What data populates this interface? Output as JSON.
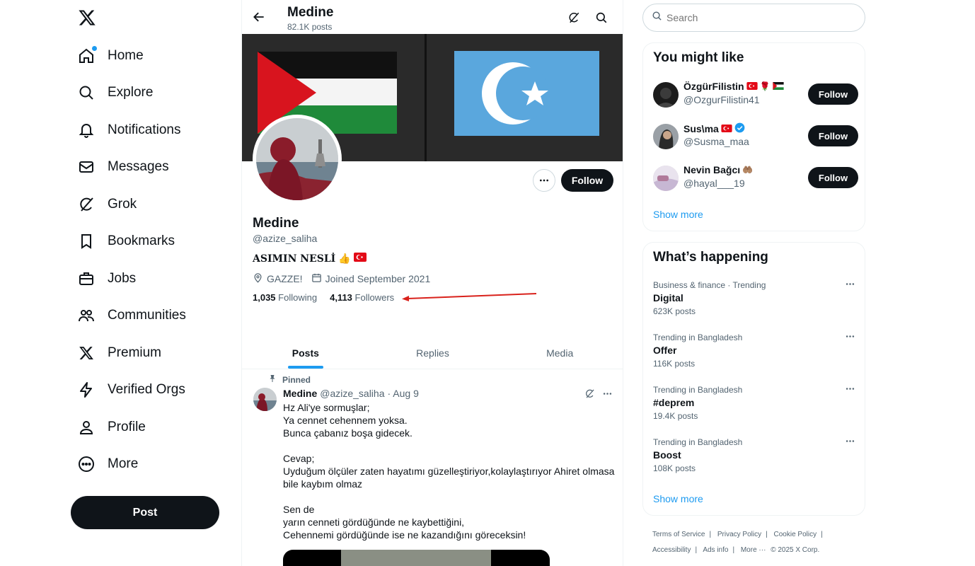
{
  "nav": {
    "items": [
      {
        "label": "Home",
        "icon": "home-icon"
      },
      {
        "label": "Explore",
        "icon": "search-icon"
      },
      {
        "label": "Notifications",
        "icon": "bell-icon"
      },
      {
        "label": "Messages",
        "icon": "envelope-icon"
      },
      {
        "label": "Grok",
        "icon": "grok-icon"
      },
      {
        "label": "Bookmarks",
        "icon": "bookmark-icon"
      },
      {
        "label": "Jobs",
        "icon": "briefcase-icon"
      },
      {
        "label": "Communities",
        "icon": "people-icon"
      },
      {
        "label": "Premium",
        "icon": "x-logo-icon"
      },
      {
        "label": "Verified Orgs",
        "icon": "lightning-icon"
      },
      {
        "label": "Profile",
        "icon": "person-icon"
      },
      {
        "label": "More",
        "icon": "more-circle-icon"
      }
    ],
    "post_label": "Post"
  },
  "header": {
    "name": "Medine",
    "posts": "82.1K posts"
  },
  "profile": {
    "name": "Medine",
    "handle": "@azize_saliha",
    "bio": "ASIMIN NESLİ",
    "bio_emoji": "👍",
    "location": "GAZZE!",
    "joined": "Joined September 2021",
    "following_count": "1,035",
    "following_label": "Following",
    "followers_count": "4,113",
    "followers_label": "Followers",
    "follow_label": "Follow"
  },
  "tabs": [
    "Posts",
    "Replies",
    "Media"
  ],
  "tweet": {
    "pinned_label": "Pinned",
    "name": "Medine",
    "handle": "@azize_saliha",
    "date": "· Aug 9",
    "lines": [
      "Hz Ali'ye sormuşlar;",
      "Ya cennet cehennem yoksa.",
      "Bunca çabanız boşa gidecek.",
      "",
      "Cevap;",
      "Uyduğum ölçüler zaten hayatımı güzelleştiriyor,kolaylaştırıyor Ahiret olmasa bile kaybım olmaz",
      "",
      "Sen de",
      "yarın cenneti gördüğünde ne kaybettiğini,",
      "Cehennemi gördüğünde ise ne kazandığını göreceksin!"
    ]
  },
  "search": {
    "placeholder": "Search"
  },
  "you_might_like": {
    "title": "You might like",
    "users": [
      {
        "name": "ÖzgürFilistin",
        "handle": "@OzgurFilistin41",
        "emoji": "🌹"
      },
      {
        "name": "Sus\\ma",
        "handle": "@Susma_maa",
        "emoji": ""
      },
      {
        "name": "Nevin Bağcı",
        "handle": "@hayal___19",
        "emoji": "🤲🏽"
      }
    ],
    "follow_label": "Follow",
    "show_more": "Show more"
  },
  "whats_happening": {
    "title": "What’s happening",
    "trends": [
      {
        "context": "Business & finance · Trending",
        "topic": "Digital",
        "count": "623K posts"
      },
      {
        "context": "Trending in Bangladesh",
        "topic": "Offer",
        "count": "116K posts"
      },
      {
        "context": "Trending in Bangladesh",
        "topic": "#deprem",
        "count": "19.4K posts"
      },
      {
        "context": "Trending in Bangladesh",
        "topic": "Boost",
        "count": "108K posts"
      }
    ],
    "show_more": "Show more"
  },
  "footer": {
    "links": [
      "Terms of Service",
      "Privacy Policy",
      "Cookie Policy",
      "Accessibility",
      "Ads info",
      "More ···"
    ],
    "copyright": "© 2025 X Corp."
  },
  "colors": {
    "accent": "#1d9bf0",
    "text": "#0f1419",
    "muted": "#536471",
    "annotation_arrow": "#d9221c"
  }
}
